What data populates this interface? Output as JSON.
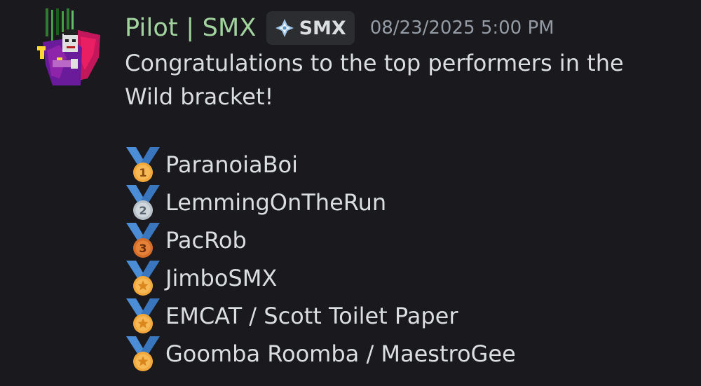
{
  "author": {
    "username": "Pilot | SMX",
    "name_color": "#a3d4a0",
    "avatar_icon": "pixel-vampire-avatar"
  },
  "server_tag": {
    "icon": "diamond-cross-icon",
    "label": "SMX"
  },
  "timestamp": "08/23/2025 5:00 PM",
  "message": {
    "intro": "Congratulations to the top performers in the Wild bracket!",
    "rankings": [
      {
        "medal": "first-place-medal-icon",
        "medal_number": "1",
        "player": "ParanoiaBoi"
      },
      {
        "medal": "second-place-medal-icon",
        "medal_number": "2",
        "player": "LemmingOnTheRun"
      },
      {
        "medal": "third-place-medal-icon",
        "medal_number": "3",
        "player": "PacRob"
      },
      {
        "medal": "star-medal-icon",
        "player": "JimboSMX"
      },
      {
        "medal": "star-medal-icon",
        "player": "EMCAT / Scott Toilet Paper"
      },
      {
        "medal": "star-medal-icon",
        "player": "Goomba Roomba / MaestroGee"
      }
    ]
  },
  "colors": {
    "background": "#1a1a1e",
    "text": "#dbdee1",
    "muted": "#949ba4",
    "ribbon": "#4b8dd6",
    "gold": "#f2a83b",
    "silver": "#cfd6dc",
    "bronze": "#e4823a"
  }
}
